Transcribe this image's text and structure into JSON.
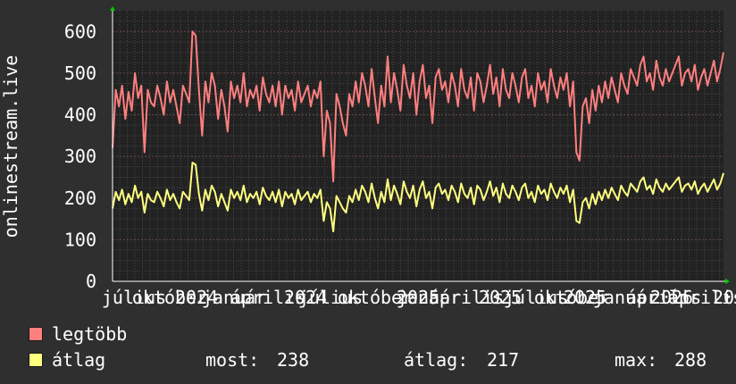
{
  "chart_data": {
    "type": "line",
    "ylabel": "onlinestream.live",
    "ylim": [
      0,
      650
    ],
    "y_ticks": [
      0,
      100,
      200,
      300,
      400,
      500,
      600
    ],
    "x_tick_labels": [
      "július",
      "október",
      "2024",
      "január",
      "április",
      "2024",
      "július",
      "október",
      "2025",
      "január",
      "április",
      "2025",
      "július",
      "október",
      "2025",
      "január",
      "április",
      "2026",
      "április",
      "20"
    ],
    "x_period_weeks": 150,
    "grid": true,
    "background": "#222222",
    "grid_color": "#4a4a4a",
    "series": [
      {
        "name": "legtöbb",
        "color": "#ff7f7f",
        "values": [
          320,
          460,
          420,
          470,
          390,
          455,
          410,
          500,
          440,
          470,
          310,
          460,
          430,
          420,
          470,
          440,
          400,
          480,
          430,
          460,
          420,
          380,
          470,
          450,
          430,
          600,
          590,
          460,
          350,
          480,
          430,
          500,
          470,
          390,
          460,
          420,
          360,
          480,
          440,
          470,
          430,
          500,
          420,
          460,
          440,
          470,
          410,
          490,
          450,
          430,
          470,
          420,
          480,
          400,
          470,
          440,
          460,
          410,
          480,
          430,
          450,
          470,
          420,
          460,
          440,
          480,
          300,
          410,
          380,
          240,
          450,
          420,
          380,
          350,
          450,
          420,
          480,
          430,
          500,
          470,
          420,
          510,
          440,
          380,
          470,
          420,
          540,
          430,
          500,
          460,
          410,
          520,
          470,
          440,
          500,
          400,
          480,
          520,
          440,
          470,
          380,
          490,
          510,
          460,
          480,
          430,
          500,
          470,
          420,
          510,
          460,
          440,
          490,
          410,
          500,
          480,
          430,
          470,
          520,
          450,
          490,
          420,
          510,
          460,
          440,
          500,
          470,
          430,
          490,
          510,
          440,
          470,
          420,
          500,
          460,
          480,
          430,
          510,
          470,
          440,
          490,
          460,
          500,
          420,
          480,
          310,
          290,
          420,
          440,
          380,
          460,
          410,
          470,
          430,
          480,
          440,
          490,
          460,
          430,
          500,
          470,
          450,
          510,
          490,
          470,
          520,
          540,
          480,
          500,
          460,
          530,
          490,
          470,
          510,
          480,
          500,
          520,
          540,
          470,
          500,
          510,
          480,
          520,
          460,
          490,
          510,
          470,
          500,
          530,
          480,
          510,
          550
        ]
      },
      {
        "name": "átlag",
        "color": "#ffff80",
        "values": [
          175,
          215,
          195,
          220,
          185,
          210,
          190,
          230,
          200,
          215,
          165,
          210,
          195,
          190,
          215,
          200,
          180,
          220,
          195,
          210,
          190,
          175,
          215,
          205,
          195,
          285,
          280,
          210,
          170,
          220,
          195,
          230,
          215,
          180,
          210,
          190,
          170,
          220,
          200,
          215,
          195,
          230,
          190,
          210,
          200,
          215,
          185,
          225,
          205,
          195,
          215,
          190,
          220,
          180,
          215,
          200,
          210,
          185,
          220,
          195,
          205,
          215,
          190,
          210,
          200,
          220,
          145,
          190,
          175,
          120,
          205,
          190,
          175,
          165,
          205,
          190,
          220,
          195,
          230,
          215,
          190,
          235,
          200,
          175,
          215,
          190,
          245,
          195,
          230,
          210,
          185,
          240,
          215,
          200,
          230,
          180,
          220,
          240,
          200,
          215,
          175,
          225,
          235,
          210,
          220,
          195,
          230,
          215,
          190,
          235,
          210,
          200,
          225,
          185,
          230,
          220,
          195,
          215,
          240,
          205,
          225,
          190,
          235,
          210,
          200,
          230,
          215,
          195,
          225,
          235,
          200,
          215,
          190,
          230,
          210,
          220,
          195,
          235,
          215,
          200,
          225,
          210,
          230,
          190,
          220,
          145,
          140,
          190,
          200,
          175,
          210,
          185,
          215,
          195,
          220,
          200,
          225,
          210,
          195,
          230,
          215,
          205,
          235,
          225,
          215,
          240,
          250,
          220,
          230,
          210,
          245,
          225,
          215,
          235,
          220,
          230,
          240,
          250,
          215,
          230,
          235,
          220,
          240,
          210,
          225,
          235,
          215,
          230,
          245,
          220,
          235,
          260
        ]
      }
    ]
  },
  "legend": {
    "max_label": "legtöbb",
    "avg_label": "átlag",
    "stats": [
      {
        "label": "most:",
        "value": "238"
      },
      {
        "label": "átlag:",
        "value": "217"
      },
      {
        "label": "max:",
        "value": "288"
      }
    ]
  }
}
